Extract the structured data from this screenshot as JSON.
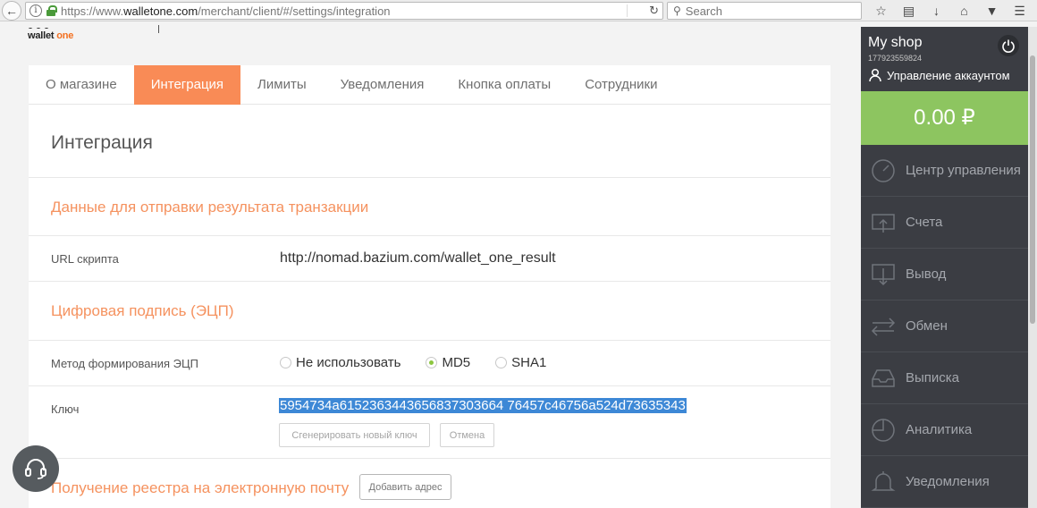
{
  "browser": {
    "url_prefix": "https://www.",
    "url_domain": "walletone.com",
    "url_path": "/merchant/client/#/settings/integration",
    "search_placeholder": "Search"
  },
  "logo": {
    "wallet": "wallet",
    "one": "one"
  },
  "tabs": [
    {
      "label": "О магазине",
      "active": false
    },
    {
      "label": "Интеграция",
      "active": true
    },
    {
      "label": "Лимиты",
      "active": false
    },
    {
      "label": "Уведомления",
      "active": false
    },
    {
      "label": "Кнопка оплаты",
      "active": false
    },
    {
      "label": "Сотрудники",
      "active": false
    }
  ],
  "page": {
    "title": "Интеграция",
    "section_transaction": "Данные для отправки результата транзакции",
    "url_label": "URL скрипта",
    "url_value": "http://nomad.bazium.com/wallet_one_result",
    "section_signature": "Цифровая подпись (ЭЦП)",
    "method_label": "Метод формирования ЭЦП",
    "methods": [
      {
        "label": "Не использовать",
        "checked": false
      },
      {
        "label": "MD5",
        "checked": true
      },
      {
        "label": "SHA1",
        "checked": false
      }
    ],
    "key_label": "Ключ",
    "key_value": "5954734a6152363443656837303664 76457c46756a524d73635343",
    "generate_button": "Сгенерировать новый ключ",
    "cancel_button": "Отмена",
    "section_email": "Получение реестра на электронную почту",
    "add_address_button": "Добавить адрес"
  },
  "sidebar": {
    "shop_name": "My shop",
    "shop_id": "177923559824",
    "account_label": "Управление аккаунтом",
    "balance": "0.00 ₽",
    "menu": [
      {
        "label": "Центр управления",
        "icon": "gauge-icon"
      },
      {
        "label": "Счета",
        "icon": "invoice-icon"
      },
      {
        "label": "Вывод",
        "icon": "withdraw-icon"
      },
      {
        "label": "Обмен",
        "icon": "exchange-icon"
      },
      {
        "label": "Выписка",
        "icon": "tray-icon"
      },
      {
        "label": "Аналитика",
        "icon": "pie-chart-icon"
      },
      {
        "label": "Уведомления",
        "icon": "bell-icon"
      }
    ]
  },
  "colors": {
    "accent": "#f98b56",
    "balance": "#8dc560",
    "sidebar": "#3b3d43"
  }
}
